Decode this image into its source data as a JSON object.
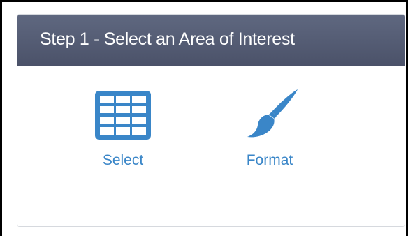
{
  "panel": {
    "title": "Step 1 - Select an Area of Interest"
  },
  "tools": {
    "select": {
      "label": "Select",
      "icon": "table-grid-icon"
    },
    "format": {
      "label": "Format",
      "icon": "paintbrush-icon"
    }
  },
  "colors": {
    "header_bg": "#525a72",
    "accent": "#3a86c8",
    "header_text": "#ffffff"
  }
}
